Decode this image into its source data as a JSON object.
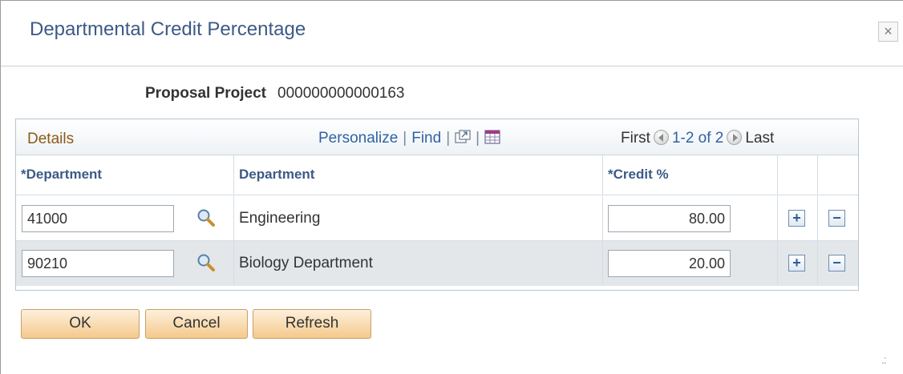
{
  "dialog": {
    "title": "Departmental Credit Percentage",
    "close_label": "×"
  },
  "field": {
    "label": "Proposal Project",
    "value": "000000000000163"
  },
  "grid": {
    "title": "Details",
    "personalize_label": "Personalize",
    "find_label": "Find",
    "separator": "|",
    "nav": {
      "first_label": "First",
      "range_label": "1-2 of 2",
      "last_label": "Last"
    },
    "columns": [
      "*Department",
      "Department",
      "*Credit %"
    ],
    "rows": [
      {
        "dept_id": "41000",
        "dept_name": "Engineering",
        "credit": "80.00"
      },
      {
        "dept_id": "90210",
        "dept_name": "Biology Department",
        "credit": "20.00"
      }
    ],
    "add_label": "+",
    "remove_label": "−"
  },
  "buttons": {
    "ok_label": "OK",
    "cancel_label": "Cancel",
    "refresh_label": "Refresh"
  },
  "icons": {
    "lookup": "magnifier-icon",
    "zoom": "new-window-icon",
    "download": "spreadsheet-icon",
    "prev": "previous-arrow-icon",
    "next": "next-arrow-icon"
  },
  "colors": {
    "title": "#3c5a86",
    "grid_title": "#8b5a17",
    "link": "#2f63a4",
    "button_bg": "#f5c98b",
    "alt_row": "#e3e7ea"
  }
}
